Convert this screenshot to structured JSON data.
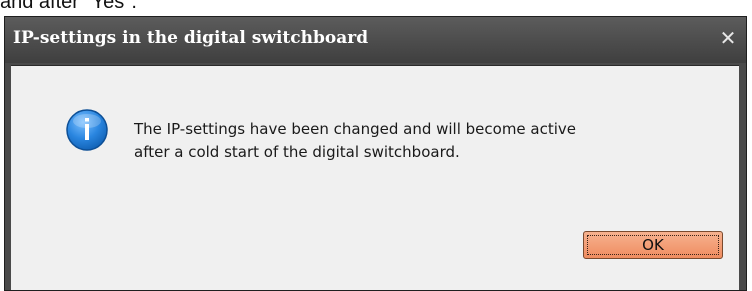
{
  "background_text": "and after \"Yes\".",
  "dialog": {
    "title": "IP-settings in the digital switchboard",
    "close_symbol": "✕",
    "icon": "info-icon",
    "message_line_1": "The IP-settings have been changed and will become active",
    "message_line_2": "after a cold start of the digital switchboard.",
    "ok_label": "OK"
  },
  "colors": {
    "titlebar": "#4a4a4a",
    "dialog_body": "#f0f0f0",
    "ok_button": "#f29a72",
    "info_icon": "#1f7fd6"
  }
}
